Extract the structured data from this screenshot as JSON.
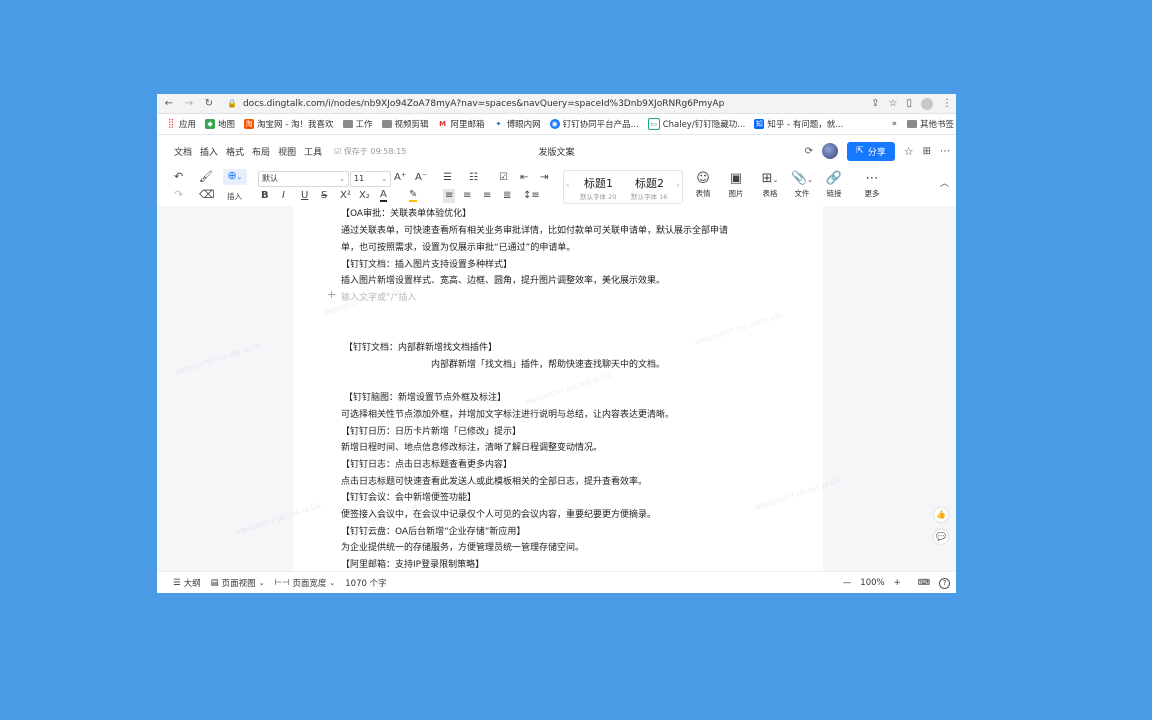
{
  "browser": {
    "url": "docs.dingtalk.com/i/nodes/nb9XJo94ZoA78myA?nav=spaces&navQuery=spaceId%3Dnb9XJoRNRg6PmyAp"
  },
  "bookmarks": {
    "apps": "应用",
    "items": [
      "地图",
      "淘宝网 - 淘！我喜欢",
      "工作",
      "视频剪辑",
      "阿里邮箱",
      "博眼内网",
      "钉钉协同平台产品...",
      "Chaley/钉钉隐藏功...",
      "知乎 - 有问题，就..."
    ],
    "more": "»",
    "other": "其他书签"
  },
  "menu": {
    "items": [
      "文档",
      "插入",
      "格式",
      "布局",
      "视图",
      "工具"
    ],
    "saved": "保存于 09:58:15",
    "title": "发版文案",
    "share": "分享"
  },
  "toolbar": {
    "font": "默认",
    "size": "11",
    "insert_label": "插入",
    "h1": "标题1",
    "h1_sub": "默认字体 20",
    "h2": "标题2",
    "h2_sub": "默认字体 16",
    "emoji": "表情",
    "image": "图片",
    "table": "表格",
    "file": "文件",
    "link": "链接",
    "more": "更多"
  },
  "document": {
    "lines": [
      "【OA审批：关联表单体验优化】",
      "通过关联表单，可快速查看所有相关业务审批详情，比如付款单可关联申请单，默认展示全部申请",
      "单，也可按照需求，设置为仅展示审批“已通过”的申请单。",
      "【钉钉文档：插入图片支持设置多种样式】",
      "插入图片新增设置样式、宽高、边框、圆角，提升图片调整效率，美化展示效果。",
      "输入文字或“/”插入",
      "【钉钉文档：内部群新增找文档插件】",
      "内部群新增「找文档」插件，帮助快速查找聊天中的文档。",
      "【钉钉脑图：新增设置节点外框及标注】",
      "可选择相关性节点添加外框，并增加文字标注进行说明与总结，让内容表达更清晰。",
      "【钉钉日历：日历卡片新增「已修改」提示】",
      "新增日程时间、地点信息修改标注，清晰了解日程调整变动情况。",
      "【钉钉日志：点击日志标题查看更多内容】",
      "点击日志标题可快速查看此发送人或此模板相关的全部日志，提升查看效率。",
      "【钉钉会议：会中新增便签功能】",
      "便签接入会议中，在会议中记录仅个人可见的会议内容，重要纪要更方便摘录。",
      "【钉钉云盘：OA后台新增“企业存储”新应用】",
      "为企业提供统一的存储服务，方便管理员统一管理存储空间。",
      "【阿里邮箱：支持IP登录限制策略】"
    ]
  },
  "statusbar": {
    "outline": "大纲",
    "page_view": "页面视图",
    "page_width": "页面宽度",
    "word_count": "1070 个字",
    "zoom": "100%"
  }
}
